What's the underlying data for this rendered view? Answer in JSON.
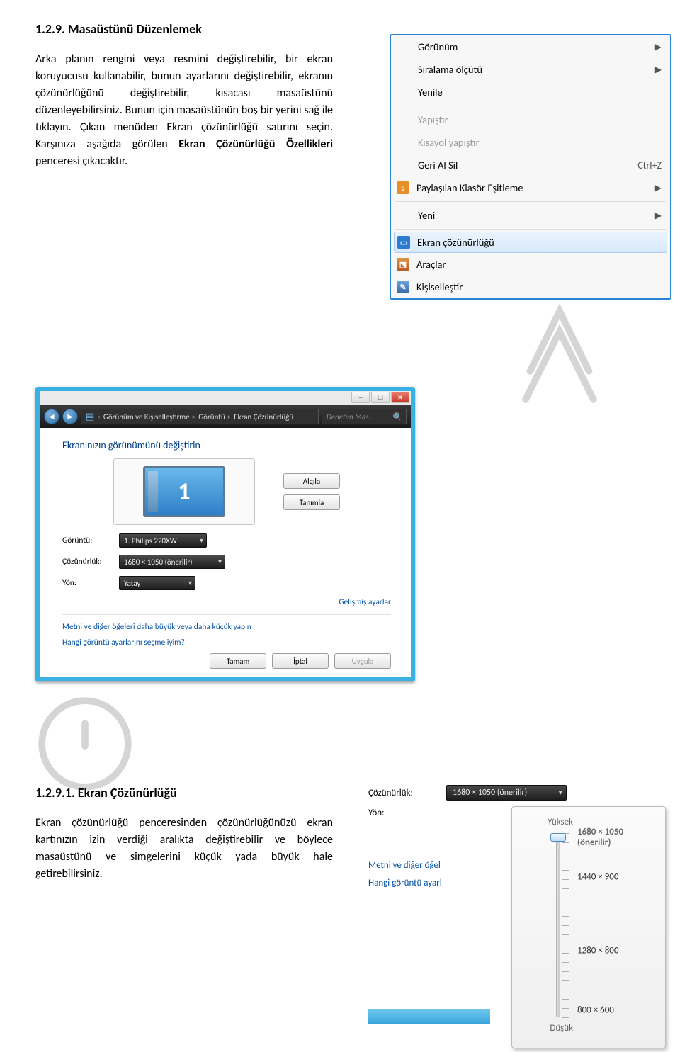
{
  "doc": {
    "heading1": "1.2.9. Masaüstünü Düzenlemek",
    "para1_prefix": "Arka planın rengini veya resmini değiştirebilir, bir ekran koruyucusu kullanabilir, bunun ayarlarını değiştirebilir, ekranın çözünürlüğünü değiştirebilir, kısacası masaüstünü düzenleyebilirsiniz. Bunun için masaüstünün boş bir yerini sağ ile tıklayın. Çıkan menüden Ekran çözünürlüğü satırını seçin. Karşınıza aşağıda görülen ",
    "para1_bold": "Ekran Çözünürlüğü Özellikleri",
    "para1_suffix": " penceresi çıkacaktır.",
    "heading2": "1.2.9.1. Ekran Çözünürlüğü",
    "para2": "Ekran çözünürlüğü penceresinden çözünürlüğünüzü ekran kartınızın izin verdiği aralıkta değiştirebilir ve böylece masaüstünü ve simgelerini küçük yada büyük hale getirebilirsiniz."
  },
  "context_menu": {
    "items": [
      {
        "label": "Görünüm",
        "submenu": true,
        "icon": ""
      },
      {
        "label": "Sıralama ölçütü",
        "submenu": true,
        "icon": ""
      },
      {
        "label": "Yenile",
        "icon": ""
      },
      {
        "sep": true
      },
      {
        "label": "Yapıştır",
        "disabled": true,
        "icon": ""
      },
      {
        "label": "Kısayol yapıştır",
        "disabled": true,
        "icon": ""
      },
      {
        "label": "Geri Al Sil",
        "shortcut": "Ctrl+Z",
        "icon": ""
      },
      {
        "label": "Paylaşılan Klasör Eşitleme",
        "submenu": true,
        "icon": "sync",
        "icon_glyph": "S",
        "icon_color": "#e7902a"
      },
      {
        "sep": true
      },
      {
        "label": "Yeni",
        "submenu": true,
        "icon": ""
      },
      {
        "sep": true
      },
      {
        "label": "Ekran çözünürlüğü",
        "highlight": true,
        "icon": "display",
        "icon_color": "#2d7bd1"
      },
      {
        "label": "Araçlar",
        "icon": "gadgets",
        "icon_color": "#d46b36"
      },
      {
        "label": "Kişiselleştir",
        "icon": "personalize",
        "icon_color": "#3b6fb7"
      }
    ]
  },
  "reswin": {
    "titlebar": {
      "min": "─",
      "max": "☐",
      "close": "✕"
    },
    "address": {
      "path": [
        "Görünüm ve Kişiselleştirme",
        "Görüntü",
        "Ekran Çözünürlüğü"
      ],
      "search_placeholder": "Denetim Mas…"
    },
    "heading": "Ekranınızın görünümünü değiştirin",
    "monitor_number": "1",
    "btn_detect": "Algıla",
    "btn_identify": "Tanımla",
    "rows": {
      "display_label": "Görüntü:",
      "display_value": "1. Philips 220XW",
      "resolution_label": "Çözünürlük:",
      "resolution_value": "1680 × 1050 (önerilir)",
      "orientation_label": "Yön:",
      "orientation_value": "Yatay"
    },
    "advanced": "Gelişmiş ayarlar",
    "help1": "Metni ve diğer öğeleri daha büyük veya daha küçük yapın",
    "help2": "Hangi görüntü ayarlarını seçmeliyim?",
    "btn_ok": "Tamam",
    "btn_cancel": "İptal",
    "btn_apply": "Uygula"
  },
  "res_popup": {
    "resolution_label": "Çözünürlük:",
    "resolution_value": "1680 × 1050 (önerilir)",
    "orientation_label": "Yön:",
    "slider": {
      "high": "Yüksek",
      "low": "Düşük",
      "options": [
        {
          "label": "1680 × 1050 (önerilir)",
          "pos": 0
        },
        {
          "label": "1440 × 900",
          "pos": 56
        },
        {
          "label": "1280 × 800",
          "pos": 160
        },
        {
          "label": "800 × 600",
          "pos": 244
        }
      ]
    },
    "cutoff": {
      "link1": "Metni ve diğer öğel",
      "link2": "Hangi görüntü ayarl"
    }
  }
}
